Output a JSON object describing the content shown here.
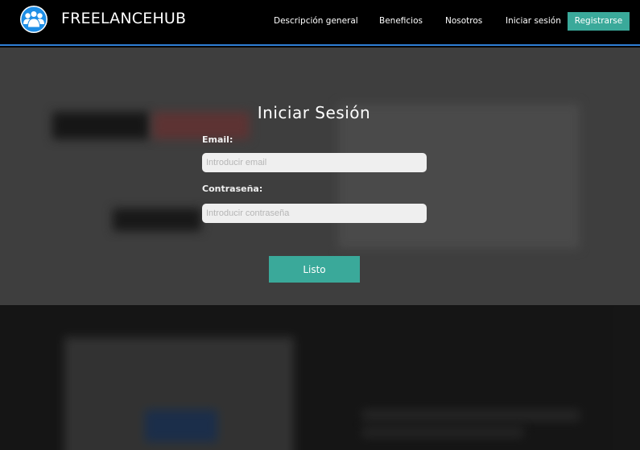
{
  "nav": {
    "brand": "FREELANCEHUB",
    "links": [
      "Descripción general",
      "Beneficios",
      "Nosotros",
      "Iniciar sesión"
    ],
    "register_label": "Registrarse"
  },
  "modal": {
    "title": "Iniciar Sesión",
    "email_label": "Email:",
    "email_placeholder": "Introducir email",
    "email_value": "",
    "password_label": "Contraseña:",
    "password_placeholder": "Introducir contraseña",
    "password_value": "",
    "submit_label": "Listo"
  },
  "icons": {
    "logo": "users-group-icon"
  },
  "colors": {
    "accent": "#3aa99a",
    "nav_border": "#2f7fd6",
    "logo_blue": "#1e8ee6"
  }
}
